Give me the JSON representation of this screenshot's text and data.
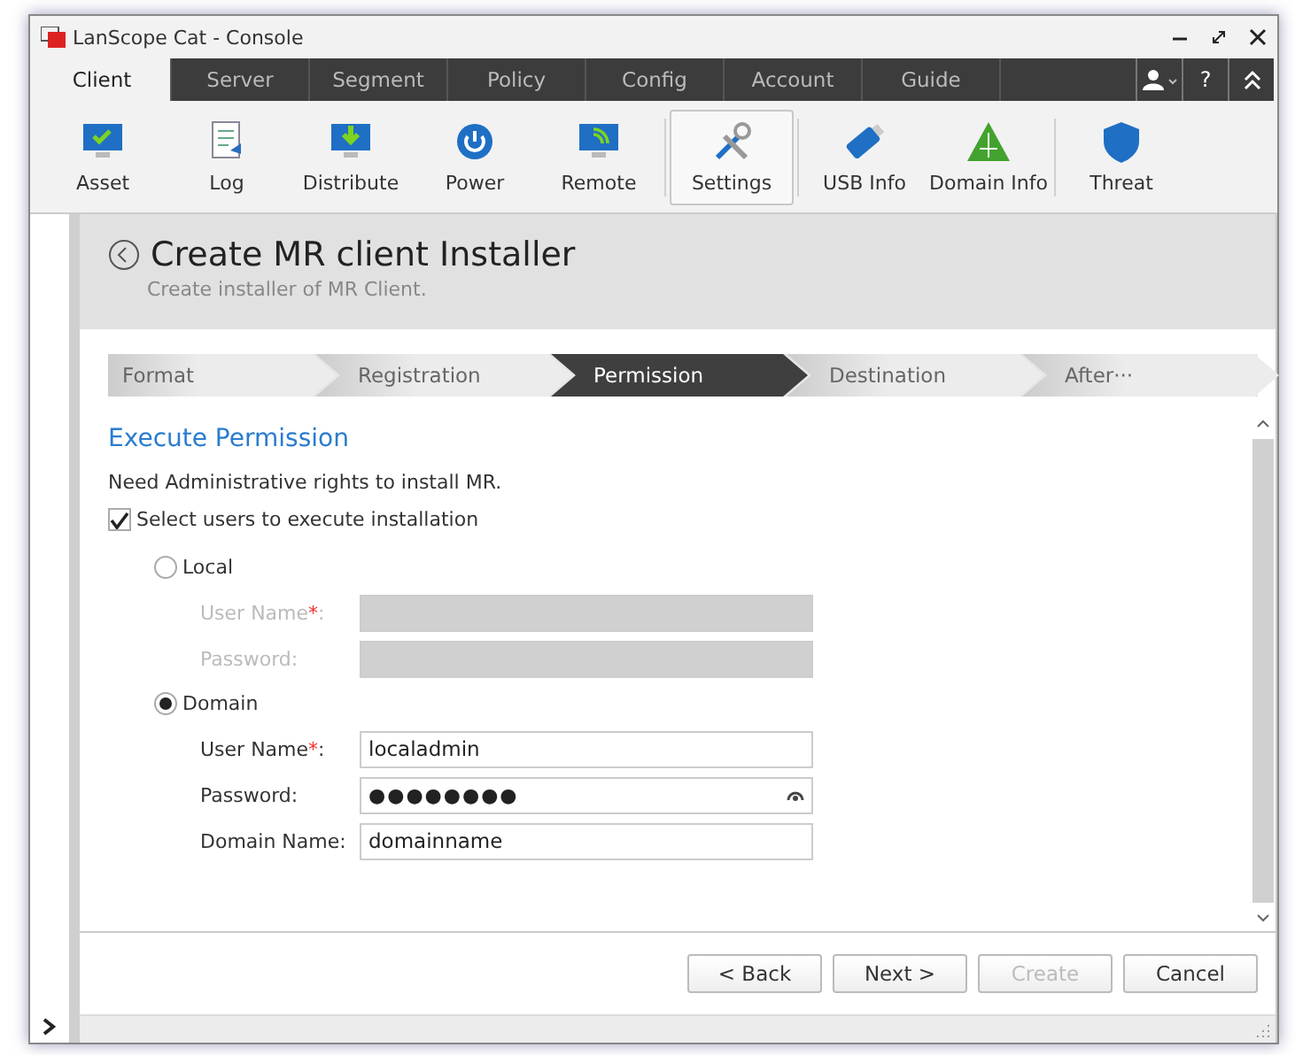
{
  "window": {
    "title": "LanScope Cat - Console"
  },
  "top_tabs": [
    {
      "label": "Client",
      "selected": true
    },
    {
      "label": "Server",
      "selected": false
    },
    {
      "label": "Segment",
      "selected": false
    },
    {
      "label": "Policy",
      "selected": false
    },
    {
      "label": "Config",
      "selected": false
    },
    {
      "label": "Account",
      "selected": false
    },
    {
      "label": "Guide",
      "selected": false
    }
  ],
  "help_button": "?",
  "toolbar": [
    {
      "label": "Asset",
      "kind": "monitor-check",
      "selected": false
    },
    {
      "label": "Log",
      "kind": "document",
      "selected": false
    },
    {
      "label": "Distribute",
      "kind": "monitor-download",
      "selected": false
    },
    {
      "label": "Power",
      "kind": "power",
      "selected": false
    },
    {
      "label": "Remote",
      "kind": "monitor-signal",
      "selected": false
    },
    {
      "label": "Settings",
      "kind": "tools",
      "selected": true
    },
    {
      "label": "USB Info",
      "kind": "usb",
      "selected": false
    },
    {
      "label": "Domain Info",
      "kind": "triangle",
      "selected": false
    },
    {
      "label": "Threat",
      "kind": "shield",
      "selected": false
    }
  ],
  "page": {
    "title": "Create MR client Installer",
    "subtitle": "Create installer of MR Client."
  },
  "steps": [
    {
      "label": "Format",
      "selected": false
    },
    {
      "label": "Registration",
      "selected": false
    },
    {
      "label": "Permission",
      "selected": true
    },
    {
      "label": "Destination",
      "selected": false
    },
    {
      "label": "After···",
      "selected": false
    }
  ],
  "section": {
    "title": "Execute Permission",
    "note": "Need Administrative rights to install MR.",
    "checkbox": {
      "label": "Select users to execute installation",
      "checked": true
    },
    "options": [
      {
        "label": "Local",
        "selected": false,
        "fields": [
          {
            "label": "User Name",
            "required_mark": "*",
            "colon": ":"
          },
          {
            "label": "Password:"
          }
        ]
      },
      {
        "label": "Domain",
        "selected": true,
        "fields": [
          {
            "label": "User Name",
            "required_mark": "*",
            "colon": ":",
            "value": "localadmin"
          },
          {
            "label": "Password:",
            "value": "●●●●●●●●",
            "kind": "password"
          },
          {
            "label": "Domain Name:",
            "value": "domainname"
          }
        ]
      }
    ]
  },
  "buttons": [
    {
      "label": "< Back",
      "disabled": false
    },
    {
      "label": "Next >",
      "disabled": false
    },
    {
      "label": "Create",
      "disabled": true
    },
    {
      "label": "Cancel",
      "disabled": false
    }
  ]
}
